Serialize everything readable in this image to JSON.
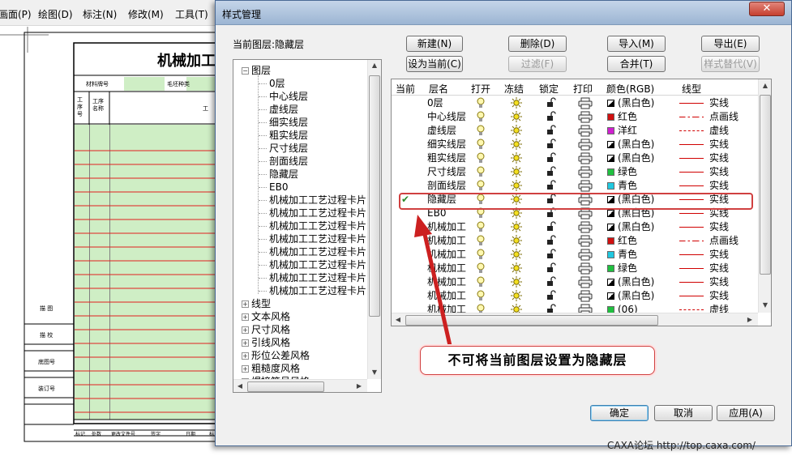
{
  "cad_menu": [
    "画面(P)",
    "绘图(D)",
    "标注(N)",
    "修改(M)",
    "工具(T)"
  ],
  "cad_drawing": {
    "title": "机械加工",
    "header_cells": [
      "材料牌号",
      "毛坯种类",
      "工"
    ],
    "col_headers": [
      "工序号",
      "工序名称"
    ],
    "side_labels": [
      "描 图",
      "描 校",
      "底图号",
      "装订号"
    ],
    "bottom_labels": [
      "标记",
      "处数",
      "更改文件号",
      "签字",
      "日期",
      "标"
    ]
  },
  "dialog": {
    "title": "样式管理",
    "close_glyph": "✕",
    "current_layer_label": "当前图层:隐藏层",
    "buttons": {
      "new": "新建(N)",
      "delete": "删除(D)",
      "import": "导入(M)",
      "export": "导出(E)",
      "set_current": "设为当前(C)",
      "filter": "过滤(F)",
      "merge": "合并(T)",
      "style_replace": "样式替代(V)",
      "ok": "确定",
      "cancel": "取消",
      "apply": "应用(A)"
    },
    "tree": {
      "root": "图层",
      "layers": [
        "0层",
        "中心线层",
        "虚线层",
        "细实线层",
        "粗实线层",
        "尺寸线层",
        "剖面线层",
        "隐藏层",
        "EB0",
        "机械加工工艺过程卡片.",
        "机械加工工艺过程卡片.",
        "机械加工工艺过程卡片.",
        "机械加工工艺过程卡片.",
        "机械加工工艺过程卡片.",
        "机械加工工艺过程卡片.",
        "机械加工工艺过程卡片.",
        "机械加工工艺过程卡片."
      ],
      "groups": [
        "线型",
        "文本风格",
        "尺寸风格",
        "引线风格",
        "形位公差风格",
        "粗糙度风格",
        "焊接符号风格"
      ]
    },
    "columns": [
      "当前",
      "层名",
      "打开",
      "冻结",
      "锁定",
      "打印",
      "颜色(RGB)",
      "线型"
    ],
    "rows": [
      {
        "current": "",
        "name": "0层",
        "color_hex": "#000000",
        "color_label": "(黑白色)",
        "bw": true,
        "ltype": "solid",
        "ltype_label": "实线"
      },
      {
        "current": "",
        "name": "中心线层",
        "color_hex": "#d01010",
        "color_label": "红色",
        "bw": false,
        "ltype": "dashdot",
        "ltype_label": "点画线"
      },
      {
        "current": "",
        "name": "虚线层",
        "color_hex": "#d020d0",
        "color_label": "洋红",
        "bw": false,
        "ltype": "dash",
        "ltype_label": "虚线"
      },
      {
        "current": "",
        "name": "细实线层",
        "color_hex": "#000000",
        "color_label": "(黑白色)",
        "bw": true,
        "ltype": "solid",
        "ltype_label": "实线"
      },
      {
        "current": "",
        "name": "粗实线层",
        "color_hex": "#000000",
        "color_label": "(黑白色)",
        "bw": true,
        "ltype": "solid",
        "ltype_label": "实线"
      },
      {
        "current": "",
        "name": "尺寸线层",
        "color_hex": "#20c040",
        "color_label": "绿色",
        "bw": false,
        "ltype": "solid",
        "ltype_label": "实线"
      },
      {
        "current": "",
        "name": "剖面线层",
        "color_hex": "#20c8e0",
        "color_label": "青色",
        "bw": false,
        "ltype": "solid",
        "ltype_label": "实线"
      },
      {
        "current": "✔",
        "name": "隐藏层",
        "color_hex": "#000000",
        "color_label": "(黑白色)",
        "bw": true,
        "ltype": "solid",
        "ltype_label": "实线"
      },
      {
        "current": "",
        "name": "EB0",
        "color_hex": "#000000",
        "color_label": "(黑白色)",
        "bw": true,
        "ltype": "solid",
        "ltype_label": "实线"
      },
      {
        "current": "",
        "name": "机械加工",
        "color_hex": "#000000",
        "color_label": "(黑白色)",
        "bw": true,
        "ltype": "solid",
        "ltype_label": "实线"
      },
      {
        "current": "",
        "name": "机械加工",
        "color_hex": "#d01010",
        "color_label": "红色",
        "bw": false,
        "ltype": "dashdot",
        "ltype_label": "点画线"
      },
      {
        "current": "",
        "name": "机械加工",
        "color_hex": "#20c8e0",
        "color_label": "青色",
        "bw": false,
        "ltype": "solid",
        "ltype_label": "实线"
      },
      {
        "current": "",
        "name": "机械加工",
        "color_hex": "#20c040",
        "color_label": "绿色",
        "bw": false,
        "ltype": "solid",
        "ltype_label": "实线"
      },
      {
        "current": "",
        "name": "机械加工",
        "color_hex": "#000000",
        "color_label": "(黑白色)",
        "bw": true,
        "ltype": "solid",
        "ltype_label": "实线"
      },
      {
        "current": "",
        "name": "机械加工",
        "color_hex": "#000000",
        "color_label": "(黑白色)",
        "bw": true,
        "ltype": "solid",
        "ltype_label": "实线"
      },
      {
        "current": "",
        "name": "机械加工",
        "color_hex": "#20c040",
        "color_label": "(06)",
        "bw": false,
        "ltype": "dash",
        "ltype_label": "虚线"
      }
    ],
    "annotation": "不可将当前图层设置为隐藏层"
  },
  "watermark": "CAXA论坛 http://top.caxa.com/",
  "colors": {
    "highlight_border": "#d04040",
    "arrow": "#cc2020",
    "green_fill": "#cfeec5",
    "red_line": "#e02020"
  }
}
